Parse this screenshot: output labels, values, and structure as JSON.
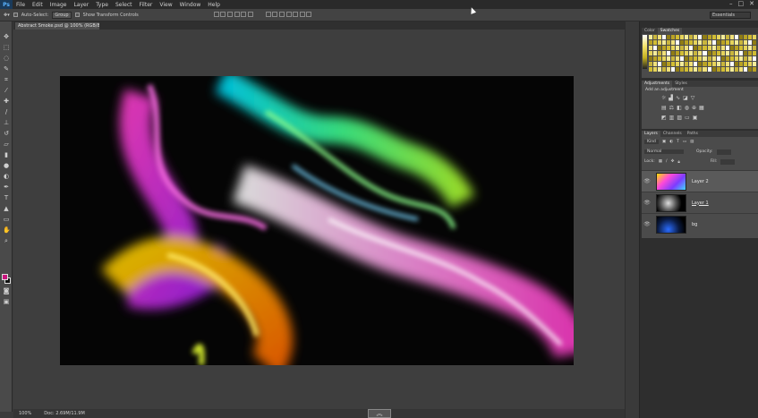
{
  "menu": {
    "logo": "Ps",
    "items": [
      "File",
      "Edit",
      "Image",
      "Layer",
      "Type",
      "Select",
      "Filter",
      "View",
      "Window",
      "Help"
    ]
  },
  "options": {
    "auto_select": "Auto-Select:",
    "group": "Group",
    "show_transform": "Show Transform Controls",
    "workspace": "Essentials"
  },
  "document": {
    "tab_title": "Abstract Smoke.psd @ 100% (RGB/8) *"
  },
  "status": {
    "zoom": "100%",
    "doc_info": "Doc: 2.69M/11.9M"
  },
  "panels": {
    "color_tabs": [
      "Color",
      "Swatches"
    ],
    "adj_tabs": [
      "Adjustments",
      "Styles"
    ],
    "add_adjustment": "Add an adjustment",
    "layer_tabs": [
      "Layers",
      "Channels",
      "Paths"
    ],
    "kind": "Kind",
    "blend_mode": "Normal",
    "opacity_label": "Opacity:",
    "lock_label": "Lock:",
    "fill_label": "Fill:",
    "layers": [
      {
        "name": "Layer 2"
      },
      {
        "name": "Layer 1"
      },
      {
        "name": "bg"
      }
    ]
  },
  "colors": {
    "foreground": "#c8147e",
    "background": "#111111"
  }
}
